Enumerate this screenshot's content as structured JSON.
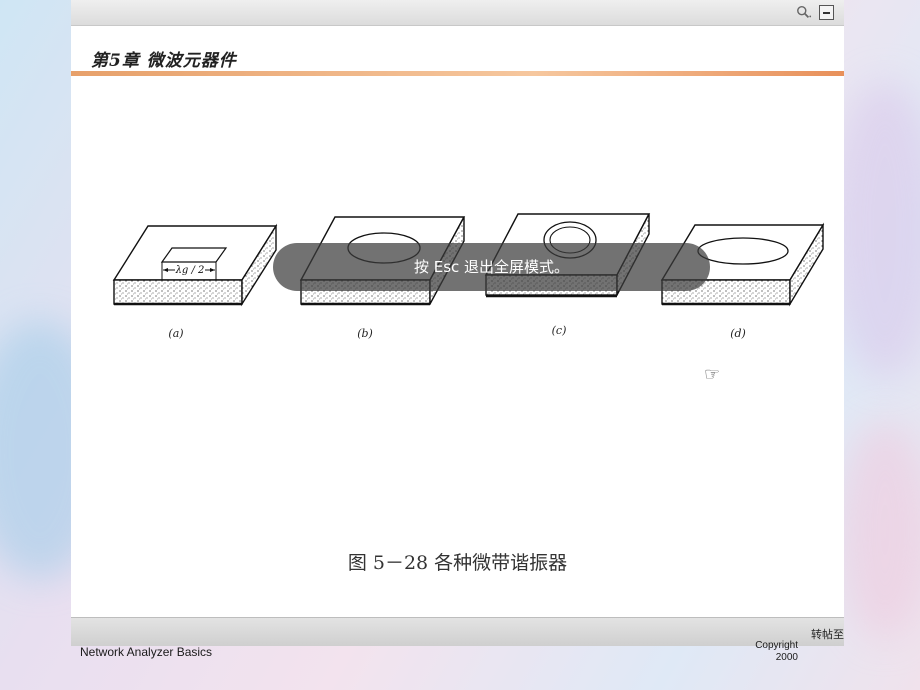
{
  "toolbar": {
    "search_icon": "search-icon",
    "minimize_icon": "minimize-icon"
  },
  "slide": {
    "chapter_title": "第5章 微波元器件",
    "subfigures": [
      {
        "label": "(a)",
        "resonator": "rectangular",
        "dimension": "λg / 2"
      },
      {
        "label": "(b)",
        "resonator": "disk"
      },
      {
        "label": "(c)",
        "resonator": "ring"
      },
      {
        "label": "(d)",
        "resonator": "ellipse"
      }
    ],
    "caption": "图 5－28 各种微带谐振器"
  },
  "bottombar": {
    "share_label": "转帖至"
  },
  "footer": {
    "left_text": "Network Analyzer Basics",
    "copyright_line1": "Copyright",
    "copyright_line2": "2000"
  },
  "toast": {
    "text": "按 Esc 退出全屏模式。"
  },
  "colors": {
    "accent_line": "#e7a06a",
    "toast_bg": "#3c3c3c"
  }
}
